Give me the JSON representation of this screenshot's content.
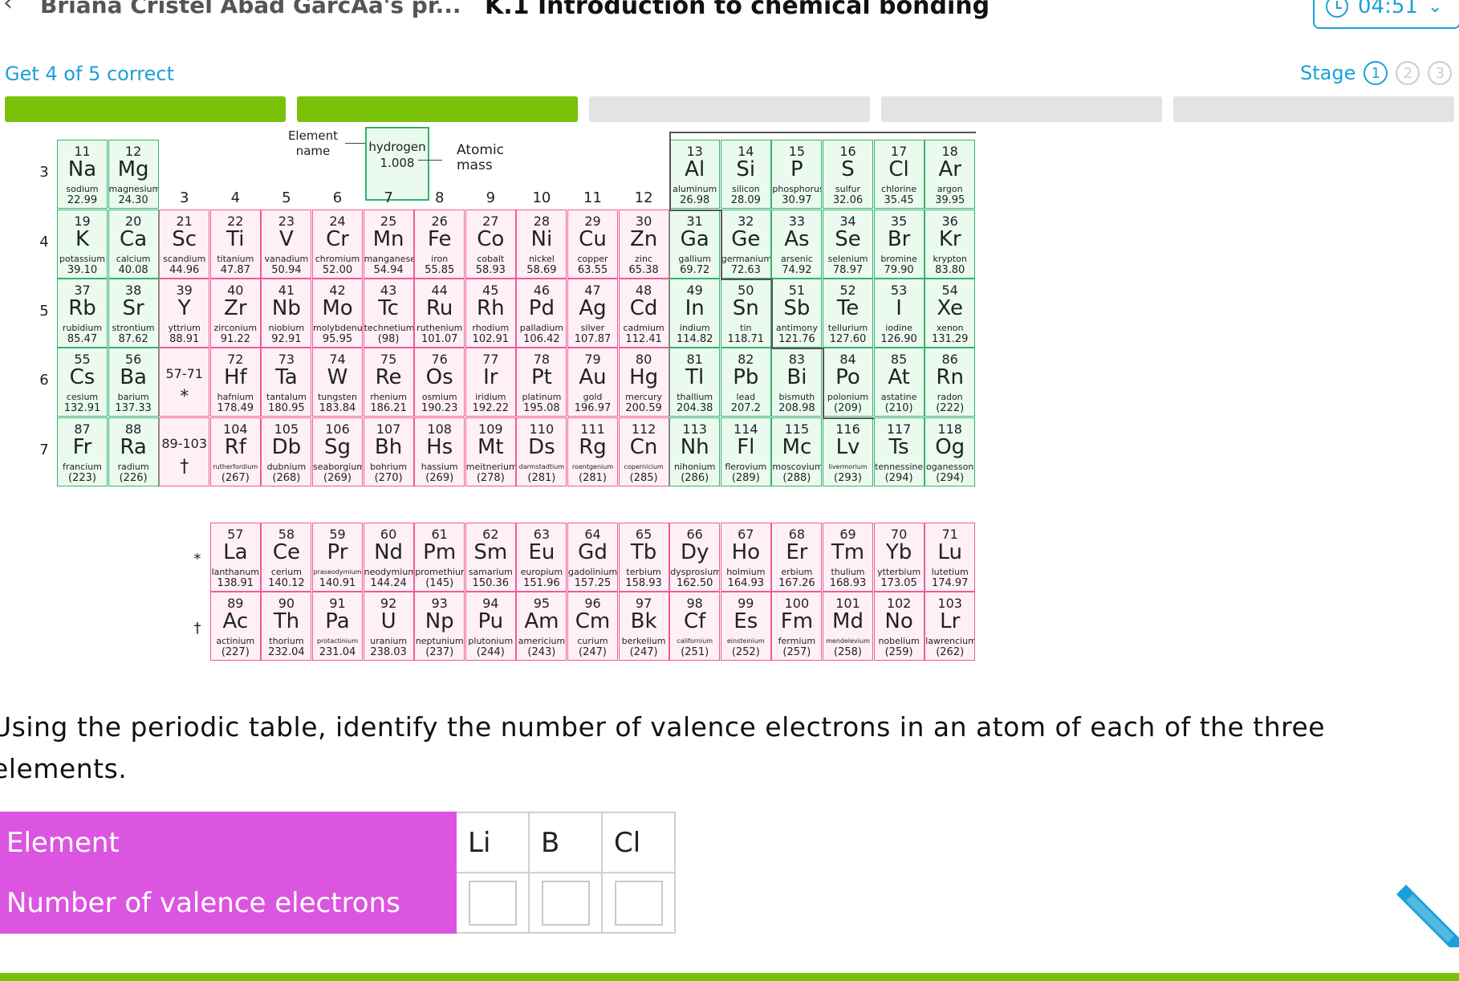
{
  "header": {
    "back_icon": "chevron-left-icon",
    "breadcrumb": "Briana Cristel Abad GarcAa's pr...",
    "title": "K.1 Introduction to chemical bonding",
    "timer": "04:51"
  },
  "goal": {
    "text": "Get 4 of 5 correct",
    "completed": 2,
    "total": 5
  },
  "stage": {
    "label": "Stage",
    "steps": [
      "1",
      "2",
      "3"
    ],
    "current": 1
  },
  "key": {
    "element_name_label": [
      "Element",
      "name"
    ],
    "name": "hydrogen",
    "mass": "1.008",
    "atomic_mass_label": [
      "Atomic",
      "mass"
    ]
  },
  "group_labels": [
    "3",
    "4",
    "5",
    "6",
    "7",
    "8",
    "9",
    "10",
    "11",
    "12"
  ],
  "period_labels": [
    "3",
    "4",
    "5",
    "6",
    "7"
  ],
  "periodic_table": [
    {
      "z": "11",
      "s": "Na",
      "n": "sodium",
      "m": "22.99",
      "r": 0,
      "c": 0,
      "t": "m"
    },
    {
      "z": "12",
      "s": "Mg",
      "n": "magnesium",
      "m": "24.30",
      "r": 0,
      "c": 1,
      "t": "m"
    },
    {
      "z": "13",
      "s": "Al",
      "n": "aluminum",
      "m": "26.98",
      "r": 0,
      "c": 12,
      "t": "m"
    },
    {
      "z": "14",
      "s": "Si",
      "n": "silicon",
      "m": "28.09",
      "r": 0,
      "c": 13,
      "t": "m"
    },
    {
      "z": "15",
      "s": "P",
      "n": "phosphorus",
      "m": "30.97",
      "r": 0,
      "c": 14,
      "t": "m"
    },
    {
      "z": "16",
      "s": "S",
      "n": "sulfur",
      "m": "32.06",
      "r": 0,
      "c": 15,
      "t": "m"
    },
    {
      "z": "17",
      "s": "Cl",
      "n": "chlorine",
      "m": "35.45",
      "r": 0,
      "c": 16,
      "t": "m"
    },
    {
      "z": "18",
      "s": "Ar",
      "n": "argon",
      "m": "39.95",
      "r": 0,
      "c": 17,
      "t": "m"
    },
    {
      "z": "19",
      "s": "K",
      "n": "potassium",
      "m": "39.10",
      "r": 1,
      "c": 0,
      "t": "m"
    },
    {
      "z": "20",
      "s": "Ca",
      "n": "calcium",
      "m": "40.08",
      "r": 1,
      "c": 1,
      "t": "m"
    },
    {
      "z": "21",
      "s": "Sc",
      "n": "scandium",
      "m": "44.96",
      "r": 1,
      "c": 2,
      "t": "tm"
    },
    {
      "z": "22",
      "s": "Ti",
      "n": "titanium",
      "m": "47.87",
      "r": 1,
      "c": 3,
      "t": "tm"
    },
    {
      "z": "23",
      "s": "V",
      "n": "vanadium",
      "m": "50.94",
      "r": 1,
      "c": 4,
      "t": "tm"
    },
    {
      "z": "24",
      "s": "Cr",
      "n": "chromium",
      "m": "52.00",
      "r": 1,
      "c": 5,
      "t": "tm"
    },
    {
      "z": "25",
      "s": "Mn",
      "n": "manganese",
      "m": "54.94",
      "r": 1,
      "c": 6,
      "t": "tm"
    },
    {
      "z": "26",
      "s": "Fe",
      "n": "iron",
      "m": "55.85",
      "r": 1,
      "c": 7,
      "t": "tm"
    },
    {
      "z": "27",
      "s": "Co",
      "n": "cobalt",
      "m": "58.93",
      "r": 1,
      "c": 8,
      "t": "tm"
    },
    {
      "z": "28",
      "s": "Ni",
      "n": "nickel",
      "m": "58.69",
      "r": 1,
      "c": 9,
      "t": "tm"
    },
    {
      "z": "29",
      "s": "Cu",
      "n": "copper",
      "m": "63.55",
      "r": 1,
      "c": 10,
      "t": "tm"
    },
    {
      "z": "30",
      "s": "Zn",
      "n": "zinc",
      "m": "65.38",
      "r": 1,
      "c": 11,
      "t": "tm"
    },
    {
      "z": "31",
      "s": "Ga",
      "n": "gallium",
      "m": "69.72",
      "r": 1,
      "c": 12,
      "t": "m"
    },
    {
      "z": "32",
      "s": "Ge",
      "n": "germanium",
      "m": "72.63",
      "r": 1,
      "c": 13,
      "t": "m"
    },
    {
      "z": "33",
      "s": "As",
      "n": "arsenic",
      "m": "74.92",
      "r": 1,
      "c": 14,
      "t": "m"
    },
    {
      "z": "34",
      "s": "Se",
      "n": "selenium",
      "m": "78.97",
      "r": 1,
      "c": 15,
      "t": "m"
    },
    {
      "z": "35",
      "s": "Br",
      "n": "bromine",
      "m": "79.90",
      "r": 1,
      "c": 16,
      "t": "m"
    },
    {
      "z": "36",
      "s": "Kr",
      "n": "krypton",
      "m": "83.80",
      "r": 1,
      "c": 17,
      "t": "m"
    },
    {
      "z": "37",
      "s": "Rb",
      "n": "rubidium",
      "m": "85.47",
      "r": 2,
      "c": 0,
      "t": "m"
    },
    {
      "z": "38",
      "s": "Sr",
      "n": "strontium",
      "m": "87.62",
      "r": 2,
      "c": 1,
      "t": "m"
    },
    {
      "z": "39",
      "s": "Y",
      "n": "yttrium",
      "m": "88.91",
      "r": 2,
      "c": 2,
      "t": "tm"
    },
    {
      "z": "40",
      "s": "Zr",
      "n": "zirconium",
      "m": "91.22",
      "r": 2,
      "c": 3,
      "t": "tm"
    },
    {
      "z": "41",
      "s": "Nb",
      "n": "niobium",
      "m": "92.91",
      "r": 2,
      "c": 4,
      "t": "tm"
    },
    {
      "z": "42",
      "s": "Mo",
      "n": "molybdenum",
      "m": "95.95",
      "r": 2,
      "c": 5,
      "t": "tm"
    },
    {
      "z": "43",
      "s": "Tc",
      "n": "technetium",
      "m": "(98)",
      "r": 2,
      "c": 6,
      "t": "tm"
    },
    {
      "z": "44",
      "s": "Ru",
      "n": "ruthenium",
      "m": "101.07",
      "r": 2,
      "c": 7,
      "t": "tm"
    },
    {
      "z": "45",
      "s": "Rh",
      "n": "rhodium",
      "m": "102.91",
      "r": 2,
      "c": 8,
      "t": "tm"
    },
    {
      "z": "46",
      "s": "Pd",
      "n": "palladium",
      "m": "106.42",
      "r": 2,
      "c": 9,
      "t": "tm"
    },
    {
      "z": "47",
      "s": "Ag",
      "n": "silver",
      "m": "107.87",
      "r": 2,
      "c": 10,
      "t": "tm"
    },
    {
      "z": "48",
      "s": "Cd",
      "n": "cadmium",
      "m": "112.41",
      "r": 2,
      "c": 11,
      "t": "tm"
    },
    {
      "z": "49",
      "s": "In",
      "n": "indium",
      "m": "114.82",
      "r": 2,
      "c": 12,
      "t": "m"
    },
    {
      "z": "50",
      "s": "Sn",
      "n": "tin",
      "m": "118.71",
      "r": 2,
      "c": 13,
      "t": "m"
    },
    {
      "z": "51",
      "s": "Sb",
      "n": "antimony",
      "m": "121.76",
      "r": 2,
      "c": 14,
      "t": "m"
    },
    {
      "z": "52",
      "s": "Te",
      "n": "tellurium",
      "m": "127.60",
      "r": 2,
      "c": 15,
      "t": "m"
    },
    {
      "z": "53",
      "s": "I",
      "n": "iodine",
      "m": "126.90",
      "r": 2,
      "c": 16,
      "t": "m"
    },
    {
      "z": "54",
      "s": "Xe",
      "n": "xenon",
      "m": "131.29",
      "r": 2,
      "c": 17,
      "t": "m"
    },
    {
      "z": "55",
      "s": "Cs",
      "n": "cesium",
      "m": "132.91",
      "r": 3,
      "c": 0,
      "t": "m"
    },
    {
      "z": "56",
      "s": "Ba",
      "n": "barium",
      "m": "137.33",
      "r": 3,
      "c": 1,
      "t": "m"
    },
    {
      "z": "72",
      "s": "Hf",
      "n": "hafnium",
      "m": "178.49",
      "r": 3,
      "c": 3,
      "t": "tm"
    },
    {
      "z": "73",
      "s": "Ta",
      "n": "tantalum",
      "m": "180.95",
      "r": 3,
      "c": 4,
      "t": "tm"
    },
    {
      "z": "74",
      "s": "W",
      "n": "tungsten",
      "m": "183.84",
      "r": 3,
      "c": 5,
      "t": "tm"
    },
    {
      "z": "75",
      "s": "Re",
      "n": "rhenium",
      "m": "186.21",
      "r": 3,
      "c": 6,
      "t": "tm"
    },
    {
      "z": "76",
      "s": "Os",
      "n": "osmium",
      "m": "190.23",
      "r": 3,
      "c": 7,
      "t": "tm"
    },
    {
      "z": "77",
      "s": "Ir",
      "n": "iridium",
      "m": "192.22",
      "r": 3,
      "c": 8,
      "t": "tm"
    },
    {
      "z": "78",
      "s": "Pt",
      "n": "platinum",
      "m": "195.08",
      "r": 3,
      "c": 9,
      "t": "tm"
    },
    {
      "z": "79",
      "s": "Au",
      "n": "gold",
      "m": "196.97",
      "r": 3,
      "c": 10,
      "t": "tm"
    },
    {
      "z": "80",
      "s": "Hg",
      "n": "mercury",
      "m": "200.59",
      "r": 3,
      "c": 11,
      "t": "tm"
    },
    {
      "z": "81",
      "s": "Tl",
      "n": "thallium",
      "m": "204.38",
      "r": 3,
      "c": 12,
      "t": "m"
    },
    {
      "z": "82",
      "s": "Pb",
      "n": "lead",
      "m": "207.2",
      "r": 3,
      "c": 13,
      "t": "m"
    },
    {
      "z": "83",
      "s": "Bi",
      "n": "bismuth",
      "m": "208.98",
      "r": 3,
      "c": 14,
      "t": "m"
    },
    {
      "z": "84",
      "s": "Po",
      "n": "polonium",
      "m": "(209)",
      "r": 3,
      "c": 15,
      "t": "m"
    },
    {
      "z": "85",
      "s": "At",
      "n": "astatine",
      "m": "(210)",
      "r": 3,
      "c": 16,
      "t": "m"
    },
    {
      "z": "86",
      "s": "Rn",
      "n": "radon",
      "m": "(222)",
      "r": 3,
      "c": 17,
      "t": "m"
    },
    {
      "z": "87",
      "s": "Fr",
      "n": "francium",
      "m": "(223)",
      "r": 4,
      "c": 0,
      "t": "m"
    },
    {
      "z": "88",
      "s": "Ra",
      "n": "radium",
      "m": "(226)",
      "r": 4,
      "c": 1,
      "t": "m"
    },
    {
      "z": "104",
      "s": "Rf",
      "n": "rutherfordium",
      "m": "(267)",
      "r": 4,
      "c": 3,
      "t": "tm"
    },
    {
      "z": "105",
      "s": "Db",
      "n": "dubnium",
      "m": "(268)",
      "r": 4,
      "c": 4,
      "t": "tm"
    },
    {
      "z": "106",
      "s": "Sg",
      "n": "seaborgium",
      "m": "(269)",
      "r": 4,
      "c": 5,
      "t": "tm"
    },
    {
      "z": "107",
      "s": "Bh",
      "n": "bohrium",
      "m": "(270)",
      "r": 4,
      "c": 6,
      "t": "tm"
    },
    {
      "z": "108",
      "s": "Hs",
      "n": "hassium",
      "m": "(269)",
      "r": 4,
      "c": 7,
      "t": "tm"
    },
    {
      "z": "109",
      "s": "Mt",
      "n": "meitnerium",
      "m": "(278)",
      "r": 4,
      "c": 8,
      "t": "tm"
    },
    {
      "z": "110",
      "s": "Ds",
      "n": "darmstadtium",
      "m": "(281)",
      "r": 4,
      "c": 9,
      "t": "tm"
    },
    {
      "z": "111",
      "s": "Rg",
      "n": "roentgenium",
      "m": "(281)",
      "r": 4,
      "c": 10,
      "t": "tm"
    },
    {
      "z": "112",
      "s": "Cn",
      "n": "copernicium",
      "m": "(285)",
      "r": 4,
      "c": 11,
      "t": "tm"
    },
    {
      "z": "113",
      "s": "Nh",
      "n": "nihonium",
      "m": "(286)",
      "r": 4,
      "c": 12,
      "t": "m"
    },
    {
      "z": "114",
      "s": "Fl",
      "n": "flerovium",
      "m": "(289)",
      "r": 4,
      "c": 13,
      "t": "m"
    },
    {
      "z": "115",
      "s": "Mc",
      "n": "moscovium",
      "m": "(288)",
      "r": 4,
      "c": 14,
      "t": "m"
    },
    {
      "z": "116",
      "s": "Lv",
      "n": "livermorium",
      "m": "(293)",
      "r": 4,
      "c": 15,
      "t": "m"
    },
    {
      "z": "117",
      "s": "Ts",
      "n": "tennessine",
      "m": "(294)",
      "r": 4,
      "c": 16,
      "t": "m"
    },
    {
      "z": "118",
      "s": "Og",
      "n": "oganesson",
      "m": "(294)",
      "r": 4,
      "c": 17,
      "t": "m"
    }
  ],
  "placeholders": [
    {
      "range": "57-71",
      "mark": "*",
      "r": 3
    },
    {
      "range": "89-103",
      "mark": "†",
      "r": 4
    }
  ],
  "lanthanides_mark": "*",
  "actinides_mark": "†",
  "lanthanides": [
    {
      "z": "57",
      "s": "La",
      "n": "lanthanum",
      "m": "138.91"
    },
    {
      "z": "58",
      "s": "Ce",
      "n": "cerium",
      "m": "140.12"
    },
    {
      "z": "59",
      "s": "Pr",
      "n": "praseodymium",
      "m": "140.91"
    },
    {
      "z": "60",
      "s": "Nd",
      "n": "neodymium",
      "m": "144.24"
    },
    {
      "z": "61",
      "s": "Pm",
      "n": "promethium",
      "m": "(145)"
    },
    {
      "z": "62",
      "s": "Sm",
      "n": "samarium",
      "m": "150.36"
    },
    {
      "z": "63",
      "s": "Eu",
      "n": "europium",
      "m": "151.96"
    },
    {
      "z": "64",
      "s": "Gd",
      "n": "gadolinium",
      "m": "157.25"
    },
    {
      "z": "65",
      "s": "Tb",
      "n": "terbium",
      "m": "158.93"
    },
    {
      "z": "66",
      "s": "Dy",
      "n": "dysprosium",
      "m": "162.50"
    },
    {
      "z": "67",
      "s": "Ho",
      "n": "holmium",
      "m": "164.93"
    },
    {
      "z": "68",
      "s": "Er",
      "n": "erbium",
      "m": "167.26"
    },
    {
      "z": "69",
      "s": "Tm",
      "n": "thulium",
      "m": "168.93"
    },
    {
      "z": "70",
      "s": "Yb",
      "n": "ytterbium",
      "m": "173.05"
    },
    {
      "z": "71",
      "s": "Lu",
      "n": "lutetium",
      "m": "174.97"
    }
  ],
  "actinides": [
    {
      "z": "89",
      "s": "Ac",
      "n": "actinium",
      "m": "(227)"
    },
    {
      "z": "90",
      "s": "Th",
      "n": "thorium",
      "m": "232.04"
    },
    {
      "z": "91",
      "s": "Pa",
      "n": "protactinium",
      "m": "231.04"
    },
    {
      "z": "92",
      "s": "U",
      "n": "uranium",
      "m": "238.03"
    },
    {
      "z": "93",
      "s": "Np",
      "n": "neptunium",
      "m": "(237)"
    },
    {
      "z": "94",
      "s": "Pu",
      "n": "plutonium",
      "m": "(244)"
    },
    {
      "z": "95",
      "s": "Am",
      "n": "americium",
      "m": "(243)"
    },
    {
      "z": "96",
      "s": "Cm",
      "n": "curium",
      "m": "(247)"
    },
    {
      "z": "97",
      "s": "Bk",
      "n": "berkelium",
      "m": "(247)"
    },
    {
      "z": "98",
      "s": "Cf",
      "n": "californium",
      "m": "(251)"
    },
    {
      "z": "99",
      "s": "Es",
      "n": "einsteinium",
      "m": "(252)"
    },
    {
      "z": "100",
      "s": "Fm",
      "n": "fermium",
      "m": "(257)"
    },
    {
      "z": "101",
      "s": "Md",
      "n": "mendelevium",
      "m": "(258)"
    },
    {
      "z": "102",
      "s": "No",
      "n": "nobelium",
      "m": "(259)"
    },
    {
      "z": "103",
      "s": "Lr",
      "n": "lawrencium",
      "m": "(262)"
    }
  ],
  "question": {
    "text": "Using the periodic table, identify the number of valence electrons in an atom of each of the three elements.",
    "row1_header": "Element",
    "row2_header": "Number of valence electrons",
    "elements": [
      "Li",
      "B",
      "Cl"
    ],
    "answers": [
      "",
      "",
      ""
    ]
  },
  "colors": {
    "accent": "#1aa0d8",
    "progress": "#7ac209",
    "header_cell": "#dc55e0",
    "main_group": "#eafaef",
    "transition": "#fff0f6"
  },
  "icons": {
    "timer": "clock-icon",
    "timer_menu": "chevron-down-icon",
    "scratchpad": "pencil-icon"
  }
}
